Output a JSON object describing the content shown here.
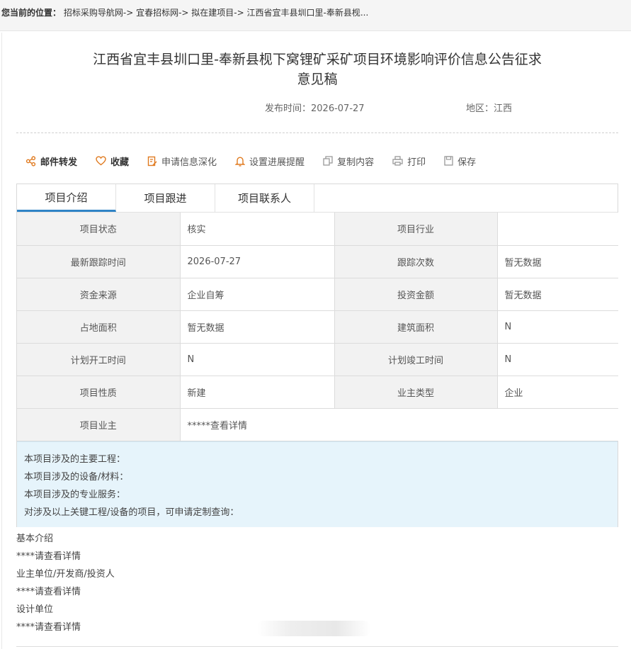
{
  "breadcrumb": {
    "label": "您当前的位置：",
    "items": [
      "招标采购导航网",
      "宜春招标网",
      "拟在建项目",
      "江西省宜丰县圳口里-奉新县枧..."
    ],
    "separator": "->"
  },
  "article": {
    "title": "江西省宜丰县圳口里-奉新县枧下窝锂矿采矿项目环境影响评价信息公告征求意见稿",
    "publish_label": "发布时间：",
    "publish_date": "2026-07-27",
    "region_label": "地区：",
    "region": "江西"
  },
  "toolbar": {
    "mail": "邮件转发",
    "favorite": "收藏",
    "apply": "申请信息深化",
    "reminder": "设置进展提醒",
    "copy": "复制内容",
    "print": "打印",
    "save": "保存"
  },
  "tabs": [
    "项目介绍",
    "项目跟进",
    "项目联系人"
  ],
  "info_rows": [
    {
      "k1": "项目状态",
      "v1": "核实",
      "k2": "项目行业",
      "v2": ""
    },
    {
      "k1": "最新跟踪时间",
      "v1": "2026-07-27",
      "k2": "跟踪次数",
      "v2": "暂无数据"
    },
    {
      "k1": "资金来源",
      "v1": "企业自筹",
      "k2": "投资金额",
      "v2": "暂无数据"
    },
    {
      "k1": "占地面积",
      "v1": "暂无数据",
      "k2": "建筑面积",
      "v2": "N"
    },
    {
      "k1": "计划开工时间",
      "v1": "N",
      "k2": "计划竣工时间",
      "v2": "N"
    },
    {
      "k1": "项目性质",
      "v1": "新建",
      "k2": "业主类型",
      "v2": "企业"
    }
  ],
  "owner_row": {
    "k": "项目业主",
    "v": "*****查看详情"
  },
  "notes": [
    "本项目涉及的主要工程：",
    "本项目涉及的设备/材料：",
    "本项目涉及的专业服务：",
    "对涉及以上关键工程/设备的项目，可申请定制查询："
  ],
  "intro": [
    "基本介绍",
    "****请查看详情",
    "业主单位/开发商/投资人",
    "****请查看详情",
    "设计单位",
    "****请查看详情"
  ],
  "colors": {
    "accent": "#e07a1f",
    "tab_active": "#2f83c6",
    "notes_bg": "#e6f4fb"
  }
}
